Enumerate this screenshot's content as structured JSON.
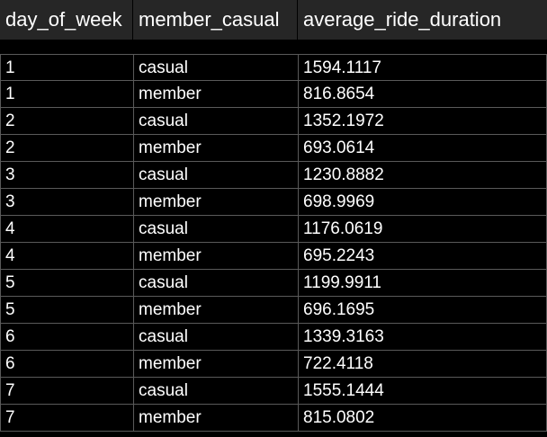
{
  "table": {
    "columns": [
      "day_of_week",
      "member_casual",
      "average_ride_duration"
    ],
    "rows": [
      [
        "1",
        "casual",
        "1594.1117"
      ],
      [
        "1",
        "member",
        "816.8654"
      ],
      [
        "2",
        "casual",
        "1352.1972"
      ],
      [
        "2",
        "member",
        "693.0614"
      ],
      [
        "3",
        "casual",
        "1230.8882"
      ],
      [
        "3",
        "member",
        "698.9969"
      ],
      [
        "4",
        "casual",
        "1176.0619"
      ],
      [
        "4",
        "member",
        "695.2243"
      ],
      [
        "5",
        "casual",
        "1199.9911"
      ],
      [
        "5",
        "member",
        "696.1695"
      ],
      [
        "6",
        "casual",
        "1339.3163"
      ],
      [
        "6",
        "member",
        "722.4118"
      ],
      [
        "7",
        "casual",
        "1555.1444"
      ],
      [
        "7",
        "member",
        "815.0802"
      ]
    ]
  },
  "colors": {
    "background": "#000000",
    "header_background": "#262626",
    "grid_line": "#5a5a5a",
    "text": "#ffffff"
  }
}
